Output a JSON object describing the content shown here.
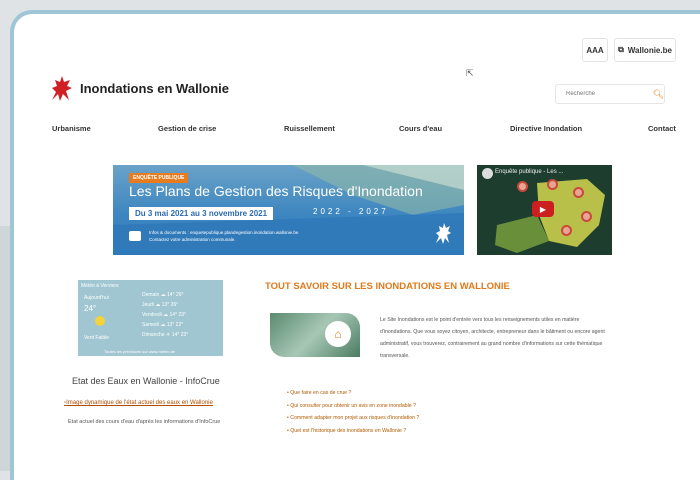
{
  "header": {
    "aaa_label": "AAA",
    "wallonie_label": "Wallonie.be",
    "site_title": "Inondations en Wallonie",
    "search_placeholder": "Recherche"
  },
  "nav": {
    "items": [
      "Urbanisme",
      "Gestion de crise",
      "Ruissellement",
      "Cours d'eau",
      "Directive Inondation",
      "Contact"
    ]
  },
  "banner": {
    "tag": "ENQUÊTE PUBLIQUE",
    "title": "Les Plans de Gestion des Risques d'Inondation",
    "dates": "Du 3 mai 2021 au 3 novembre 2021",
    "years": "2022 - 2027",
    "info_line1": "Infos & documents : enquetepublique.plandegestion.inondation.wallonie.be",
    "info_line2": "Contactez votre administration communale."
  },
  "video": {
    "title": "Enquête publique - Les ..."
  },
  "weather": {
    "header": "Météo à Verviers",
    "today_label": "Aujourd'hui",
    "temp": "24°",
    "now_label": "Vent Faible",
    "rows": [
      {
        "day": "Demain",
        "temp": "14° 26°"
      },
      {
        "day": "Jeudi",
        "temp": "13° 26°"
      },
      {
        "day": "Vendredi",
        "temp": "14° 23°"
      },
      {
        "day": "Samedi",
        "temp": "13° 22°"
      },
      {
        "day": "Dimanche",
        "temp": "14° 23°"
      }
    ],
    "footer": "Toutes les prévisions sur www.meteo.be"
  },
  "etat": {
    "title": "Etat des Eaux en Wallonie - InfoCrue",
    "image_alt": "Image dynamique de l'état actuel des eaux en Wallonie",
    "caption": "Etat actuel des cours d'eau d'après les informations d'InfoCrue"
  },
  "main": {
    "title": "TOUT SAVOIR SUR LES INONDATIONS EN WALLONIE",
    "para_1": "Le Site Inondations est le point d'entrée vers tous les renseignements utiles en matière",
    "para_2": "d'inondations. Que vous soyez citoyen, architecte, entrepreneur dans le bâtiment ou encore agent",
    "para_3": "administratif, vous trouverez, contrairement au grand nombre d'informations sur cette thématique",
    "para_4": "transversale.",
    "links": [
      "Que faire en cas de crue ?",
      "Qui consulter pour obtenir un avis en zone inondable ?",
      "Comment adapter mon projet aux risques d'inondation ?",
      "Quel est l'historique des inondations en Wallonie ?"
    ]
  },
  "colors": {
    "accent": "#e07a1c",
    "frame": "#9ec6d6",
    "banner": "#3d86c0"
  }
}
